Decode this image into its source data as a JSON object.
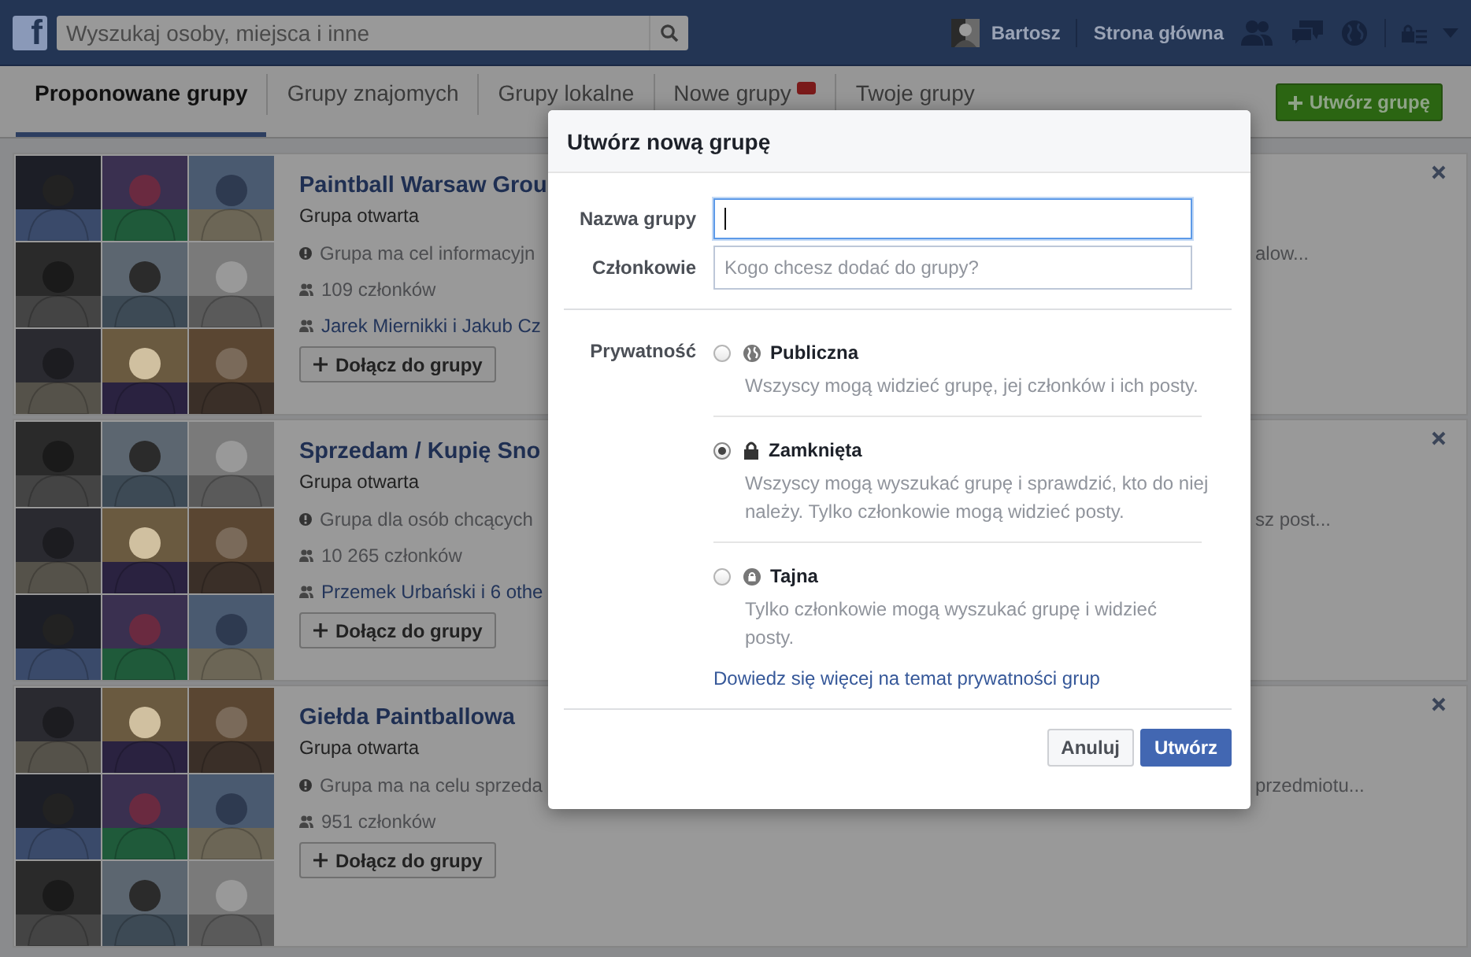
{
  "top_bar": {
    "logo": "f",
    "search": {
      "placeholder": "Wyszukaj osoby, miejsca i inne"
    },
    "user_name": "Bartosz",
    "home_link": "Strona główna"
  },
  "tabs": [
    {
      "label": "Proponowane grupy",
      "selected": true
    },
    {
      "label": "Grupy znajomych",
      "selected": false
    },
    {
      "label": "Grupy lokalne",
      "selected": false
    },
    {
      "label": "Nowe grupy",
      "selected": false,
      "badge": true
    },
    {
      "label": "Twoje grupy",
      "selected": false
    }
  ],
  "create_group_button": "Utwórz grupę",
  "groups": [
    {
      "name": "Paintball Warsaw Grou",
      "type": "Grupa otwarta",
      "description": "Grupa ma cel informacyjn",
      "description_tail": "alow...",
      "members": "109 członków",
      "friends": "Jarek Miernikki i Jakub Cz",
      "join_button": "Dołącz do grupy"
    },
    {
      "name": "Sprzedam / Kupię Sno",
      "type": "Grupa otwarta",
      "description": "Grupa dla osób chcących",
      "description_tail": "sz post...",
      "members": "10 265 członków",
      "friends": "Przemek Urbański i 6 othe",
      "join_button": "Dołącz do grupy"
    },
    {
      "name": "Giełda Paintballowa",
      "type": "Grupa otwarta",
      "description": "Grupa ma na celu sprzeda",
      "description_tail": "przedmiotu...",
      "members": "951 członków",
      "join_button": "Dołącz do grupy"
    }
  ],
  "dialog": {
    "title": "Utwórz nową grupę",
    "name_label": "Nazwa grupy",
    "members_label": "Członkowie",
    "members_placeholder": "Kogo chcesz dodać do grupy?",
    "privacy_label": "Prywatność",
    "privacy_options": [
      {
        "kind": "public",
        "label": "Publiczna",
        "description": "Wszyscy mogą widzieć grupę, jej członków i ich posty.",
        "selected": false
      },
      {
        "kind": "closed",
        "label": "Zamknięta",
        "description": "Wszyscy mogą wyszukać grupę i sprawdzić, kto do niej należy. Tylko członkowie mogą widzieć posty.",
        "selected": true
      },
      {
        "kind": "secret",
        "label": "Tajna",
        "description": "Tylko członkowie mogą wyszukać grupę i widzieć posty.",
        "selected": false
      }
    ],
    "learn_more_link": "Dowiedz się więcej na temat prywatności grup",
    "cancel_button": "Anuluj",
    "create_button": "Utwórz"
  }
}
